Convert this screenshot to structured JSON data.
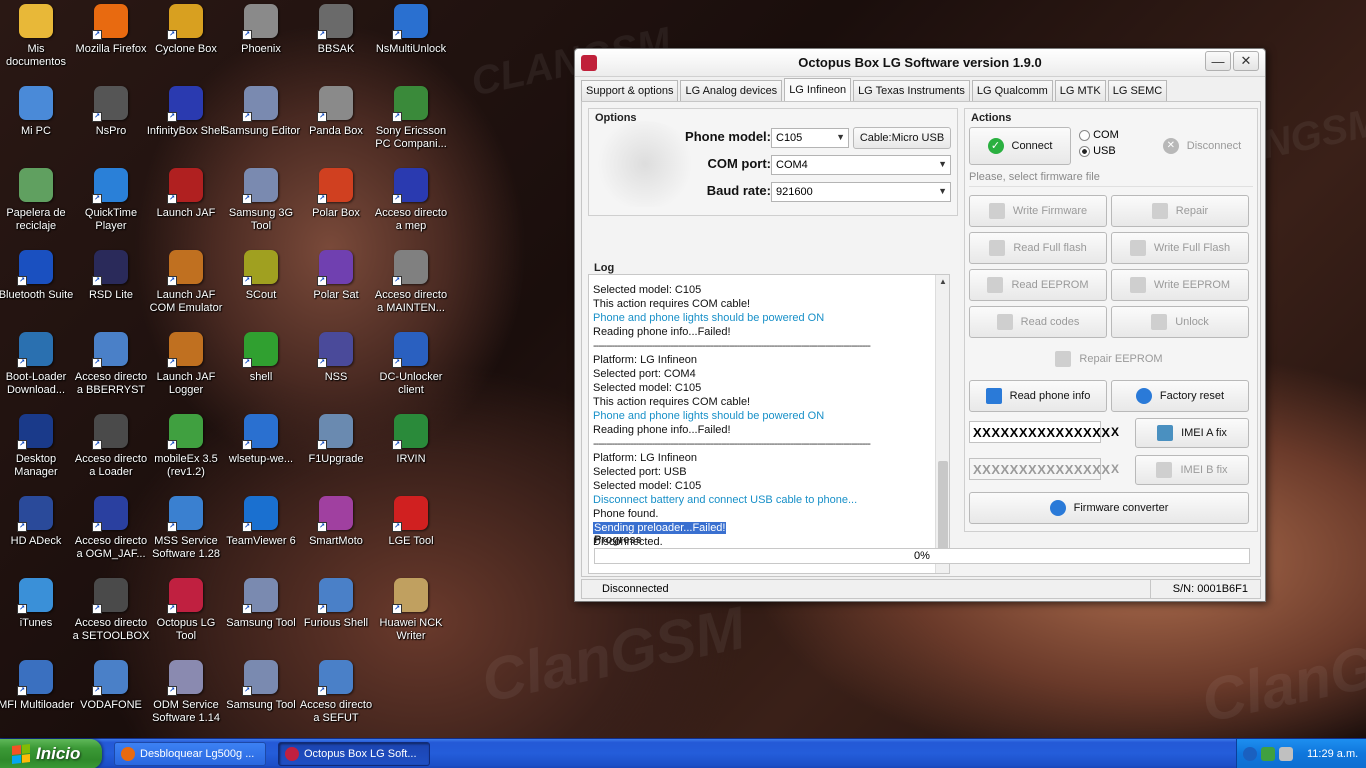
{
  "desktop": {
    "icons": [
      {
        "label": "Mis documentos",
        "icon": "folder-icon",
        "color": "#e8b838"
      },
      {
        "label": "Mozilla Firefox",
        "icon": "firefox-icon",
        "color": "#e86a10"
      },
      {
        "label": "Cyclone Box",
        "icon": "cyclone-icon",
        "color": "#d8a020"
      },
      {
        "label": "Phoenix",
        "icon": "phoenix-icon",
        "color": "#8a8a8a"
      },
      {
        "label": "BBSAK",
        "icon": "bbsak-icon",
        "color": "#6a6a6a"
      },
      {
        "label": "NsMultiUnlock",
        "icon": "globe-icon",
        "color": "#2a70d0"
      },
      {
        "label": "Mi PC",
        "icon": "computer-icon",
        "color": "#4a8ad8"
      },
      {
        "label": "NsPro",
        "icon": "phone-icon",
        "color": "#555555"
      },
      {
        "label": "InfinityBox Shell",
        "icon": "infinity-icon",
        "color": "#2a3ab0"
      },
      {
        "label": "Samsung Editor",
        "icon": "gear-icon",
        "color": "#7a8ab0"
      },
      {
        "label": "Panda Box",
        "icon": "panda-icon",
        "color": "#8a8a8a"
      },
      {
        "label": "Sony Ericsson PC Compani...",
        "icon": "sony-icon",
        "color": "#3a8a3a"
      },
      {
        "label": "Papelera de reciclaje",
        "icon": "recycle-bin-icon",
        "color": "#60a060"
      },
      {
        "label": "QuickTime Player",
        "icon": "quicktime-icon",
        "color": "#2a80d8"
      },
      {
        "label": "Launch JAF",
        "icon": "jaf-icon",
        "color": "#b02020"
      },
      {
        "label": "Samsung 3G Tool",
        "icon": "gear-icon",
        "color": "#7a8ab0"
      },
      {
        "label": "Polar Box",
        "icon": "polar-icon",
        "color": "#d04020"
      },
      {
        "label": "Acceso directo a mep",
        "icon": "infinity-icon",
        "color": "#2a3ab0"
      },
      {
        "label": "Bluetooth Suite",
        "icon": "bluetooth-icon",
        "color": "#1a50c0"
      },
      {
        "label": "RSD Lite",
        "icon": "motorola-icon",
        "color": "#2a2a5a"
      },
      {
        "label": "Launch JAF COM Emulator",
        "icon": "jaf-icon",
        "color": "#c07020"
      },
      {
        "label": "SCout",
        "icon": "scout-icon",
        "color": "#a0a020"
      },
      {
        "label": "Polar Sat",
        "icon": "polar-icon",
        "color": "#7040b0"
      },
      {
        "label": "Acceso directo a MAINTEN...",
        "icon": "tool-icon",
        "color": "#808080"
      },
      {
        "label": "Boot-Loader Download...",
        "icon": "download-icon",
        "color": "#2a70b0"
      },
      {
        "label": "Acceso directo a BBERRYST",
        "icon": "app-icon",
        "color": "#4a80c8"
      },
      {
        "label": "Launch JAF Logger",
        "icon": "jaf-icon",
        "color": "#c07020"
      },
      {
        "label": "shell",
        "icon": "play-icon",
        "color": "#30a030"
      },
      {
        "label": "NSS",
        "icon": "nss-icon",
        "color": "#4a4a9a"
      },
      {
        "label": "DC-Unlocker client",
        "icon": "unlocker-icon",
        "color": "#2a60c0"
      },
      {
        "label": "Desktop Manager",
        "icon": "blackberry-icon",
        "color": "#1a3a8a"
      },
      {
        "label": "Acceso directo a Loader",
        "icon": "phone-icon",
        "color": "#4a4a4a"
      },
      {
        "label": "mobileEx 3.5 (rev1.2)",
        "icon": "mobileex-icon",
        "color": "#40a040"
      },
      {
        "label": "wlsetup-we...",
        "icon": "windows-icon",
        "color": "#2a70d0"
      },
      {
        "label": "F1Upgrade",
        "icon": "upgrade-icon",
        "color": "#6a8ab0"
      },
      {
        "label": "IRVIN",
        "icon": "excel-icon",
        "color": "#2a8a3a"
      },
      {
        "label": "HD ADeck",
        "icon": "xda-icon",
        "color": "#2a4a9a"
      },
      {
        "label": "Acceso directo a OGM_JAF...",
        "icon": "building-icon",
        "color": "#2a40a0"
      },
      {
        "label": "MSS Service Software 1.28",
        "icon": "star-icon",
        "color": "#3a80d0"
      },
      {
        "label": "TeamViewer 6",
        "icon": "teamviewer-icon",
        "color": "#1a70d0"
      },
      {
        "label": "SmartMoto",
        "icon": "smartmoto-icon",
        "color": "#a040a0"
      },
      {
        "label": "LGE Tool",
        "icon": "lg-icon",
        "color": "#d02020"
      },
      {
        "label": "iTunes",
        "icon": "itunes-icon",
        "color": "#3a90d8"
      },
      {
        "label": "Acceso directo a SETOOLBOX",
        "icon": "phone-icon",
        "color": "#4a4a4a"
      },
      {
        "label": "Octopus LG Tool",
        "icon": "octopus-icon",
        "color": "#c02040"
      },
      {
        "label": "Samsung Tool",
        "icon": "gear-icon",
        "color": "#7a8ab0"
      },
      {
        "label": "Furious Shell",
        "icon": "app-icon",
        "color": "#4a80c8"
      },
      {
        "label": "Huawei NCK Writer",
        "icon": "document-icon",
        "color": "#c0a060"
      },
      {
        "label": "MFI Multiloader",
        "icon": "mfi-icon",
        "color": "#3a70c0"
      },
      {
        "label": "VODAFONE",
        "icon": "app-icon",
        "color": "#4a80c8"
      },
      {
        "label": "ODM Service Software 1.14",
        "icon": "cube-icon",
        "color": "#8a8ab0"
      },
      {
        "label": "Samsung Tool",
        "icon": "gear-icon",
        "color": "#7a8ab0"
      },
      {
        "label": "Acceso directo a SEFUT",
        "icon": "app-icon",
        "color": "#4a80c8"
      }
    ]
  },
  "window": {
    "title": "Octopus Box LG Software version 1.9.0",
    "minimize": "—",
    "close": "✕",
    "tabs": [
      {
        "label": "Support & options",
        "active": false
      },
      {
        "label": "LG Analog devices",
        "active": false
      },
      {
        "label": "LG Infineon",
        "active": true
      },
      {
        "label": "LG Texas Instruments",
        "active": false
      },
      {
        "label": "LG Qualcomm",
        "active": false
      },
      {
        "label": "LG MTK",
        "active": false
      },
      {
        "label": "LG SEMC",
        "active": false
      }
    ],
    "options": {
      "title": "Options",
      "phone_model_label": "Phone model:",
      "phone_model_value": "C105",
      "cable_button": "Cable:Micro USB",
      "com_port_label": "COM port:",
      "com_port_value": "COM4",
      "baud_rate_label": "Baud rate:",
      "baud_rate_value": "921600"
    },
    "log": {
      "title": "Log",
      "lines": [
        {
          "text": "Selected model: C105",
          "style": "normal"
        },
        {
          "text": "This action requires COM cable!",
          "style": "normal"
        },
        {
          "text": "Phone and phone lights should be powered ON",
          "style": "blue"
        },
        {
          "text": "Reading phone info...Failed!",
          "style": "normal"
        },
        {
          "text": "--------------------------------------------------------------------------------------------------------",
          "style": "sep"
        },
        {
          "text": "Platform: LG Infineon",
          "style": "normal"
        },
        {
          "text": "Selected port: COM4",
          "style": "normal"
        },
        {
          "text": "Selected model: C105",
          "style": "normal"
        },
        {
          "text": "This action requires COM cable!",
          "style": "normal"
        },
        {
          "text": "Phone and phone lights should be powered ON",
          "style": "blue"
        },
        {
          "text": "Reading phone info...Failed!",
          "style": "normal"
        },
        {
          "text": "--------------------------------------------------------------------------------------------------------",
          "style": "sep"
        },
        {
          "text": "Platform: LG Infineon",
          "style": "normal"
        },
        {
          "text": "Selected port: USB",
          "style": "normal"
        },
        {
          "text": "Selected model: C105",
          "style": "normal"
        },
        {
          "text": "Disconnect battery and connect USB cable to phone...",
          "style": "blue"
        },
        {
          "text": "Phone found.",
          "style": "normal"
        },
        {
          "text": "Sending preloader...Failed!",
          "style": "highlight"
        },
        {
          "text": "Disconnected.",
          "style": "normal"
        }
      ]
    },
    "actions": {
      "title": "Actions",
      "connect": "Connect",
      "radio_com": "COM",
      "radio_usb": "USB",
      "selected_radio": "USB",
      "disconnect": "Disconnect",
      "firmware_placeholder": "Please, select firmware file",
      "write_firmware": "Write Firmware",
      "repair": "Repair",
      "read_full_flash": "Read Full flash",
      "write_full_flash": "Write Full Flash",
      "read_eeprom": "Read EEPROM",
      "write_eeprom": "Write EEPROM",
      "read_codes": "Read codes",
      "unlock": "Unlock",
      "repair_eeprom": "Repair EEPROM",
      "read_phone_info": "Read phone info",
      "factory_reset": "Factory reset",
      "imei_a_value": "XXXXXXXXXXXXXXX",
      "imei_a_x": "X",
      "imei_a_fix": "IMEI A fix",
      "imei_b_value": "XXXXXXXXXXXXXXX",
      "imei_b_x": "X",
      "imei_b_fix": "IMEI B fix",
      "firmware_converter": "Firmware converter"
    },
    "progress": {
      "title": "Progress",
      "percent_text": "0%",
      "value": 0
    },
    "status": {
      "left": "Disconnected",
      "serial": "S/N: 0001B6F1"
    }
  },
  "taskbar": {
    "start_label": "Inicio",
    "items": [
      {
        "label": "Desbloquear Lg500g ...",
        "active": false,
        "color": "#e86a10"
      },
      {
        "label": "Octopus Box LG Soft...",
        "active": true,
        "color": "#c02040"
      }
    ],
    "clock": "11:29 a.m."
  },
  "colors": {
    "accent_blue": "#1890c8",
    "highlight": "#3a70d0",
    "taskbar": "#245dda",
    "start": "#3c9a37"
  }
}
